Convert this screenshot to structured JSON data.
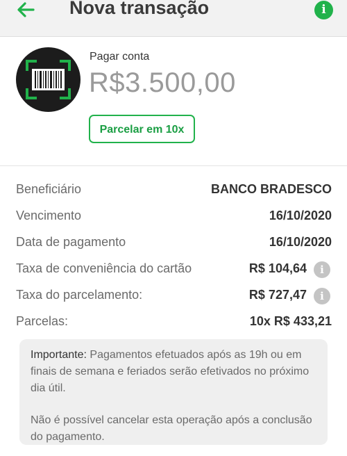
{
  "header": {
    "title": "Nova transação",
    "back_icon": "arrow-left-icon",
    "info_icon": "info-icon",
    "accent_color": "#21b24b"
  },
  "payment": {
    "label": "Pagar conta",
    "amount": "R$3.500,00",
    "installment_button": "Parcelar em 10x",
    "avatar_icon": "barcode-scan-icon"
  },
  "details": [
    {
      "label": "Beneficiário",
      "value": "BANCO BRADESCO",
      "has_help": false
    },
    {
      "label": "Vencimento",
      "value": "16/10/2020",
      "has_help": false
    },
    {
      "label": "Data de pagamento",
      "value": "16/10/2020",
      "has_help": false
    },
    {
      "label": "Taxa de conveniência do cartão",
      "value": "R$ 104,64",
      "has_help": true
    },
    {
      "label": "Taxa do parcelamento:",
      "value": "R$ 727,47",
      "has_help": true
    },
    {
      "label": "Parcelas:",
      "value": "10x R$ 433,21",
      "has_help": false
    }
  ],
  "notice": {
    "title": "Importante:",
    "text1": "Pagamentos efetuados após as 19h ou em finais de semana e feriados serão efetivados no próximo dia útil.",
    "text2": "Não é possível cancelar esta operação após a conclusão do pagamento."
  }
}
